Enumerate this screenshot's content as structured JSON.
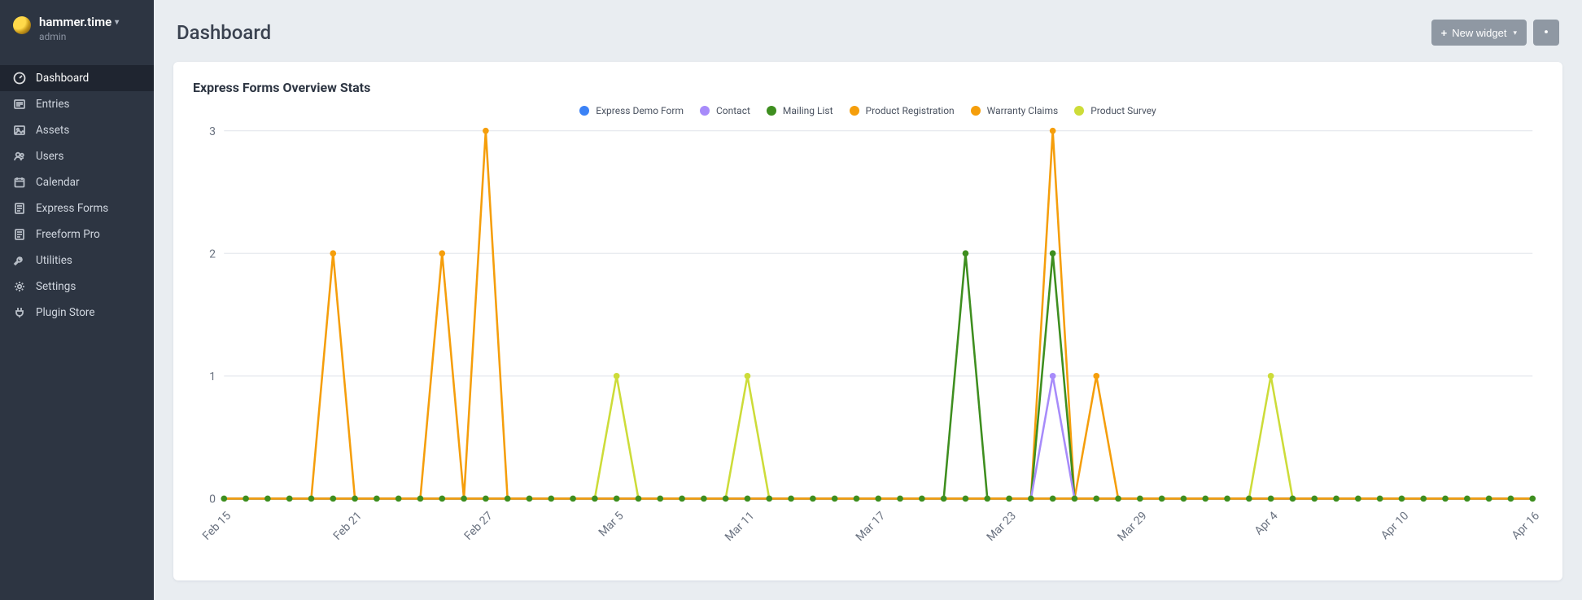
{
  "site": {
    "name": "hammer.time",
    "role": "admin"
  },
  "page": {
    "title": "Dashboard"
  },
  "toolbar": {
    "new_widget_label": "New widget"
  },
  "sidebar": {
    "items": [
      {
        "label": "Dashboard",
        "icon": "dashboard-icon",
        "active": true
      },
      {
        "label": "Entries",
        "icon": "entries-icon",
        "active": false
      },
      {
        "label": "Assets",
        "icon": "image-icon",
        "active": false
      },
      {
        "label": "Users",
        "icon": "users-icon",
        "active": false
      },
      {
        "label": "Calendar",
        "icon": "calendar-icon",
        "active": false
      },
      {
        "label": "Express Forms",
        "icon": "form-icon",
        "active": false
      },
      {
        "label": "Freeform Pro",
        "icon": "form-icon",
        "active": false
      },
      {
        "label": "Utilities",
        "icon": "wrench-icon",
        "active": false
      },
      {
        "label": "Settings",
        "icon": "gear-icon",
        "active": false
      },
      {
        "label": "Plugin Store",
        "icon": "plug-icon",
        "active": false
      }
    ]
  },
  "panel": {
    "title": "Express Forms Overview Stats"
  },
  "chart_data": {
    "type": "line",
    "ylabel": "",
    "xlabel": "",
    "ylim": [
      0,
      3
    ],
    "y_ticks": [
      0,
      1,
      2,
      3
    ],
    "categories": [
      "Feb 15",
      "Feb 16",
      "Feb 17",
      "Feb 18",
      "Feb 19",
      "Feb 20",
      "Feb 21",
      "Feb 22",
      "Feb 23",
      "Feb 24",
      "Feb 25",
      "Feb 26",
      "Feb 27",
      "Feb 28",
      "Mar 1",
      "Mar 2",
      "Mar 3",
      "Mar 4",
      "Mar 5",
      "Mar 6",
      "Mar 7",
      "Mar 8",
      "Mar 9",
      "Mar 10",
      "Mar 11",
      "Mar 12",
      "Mar 13",
      "Mar 14",
      "Mar 15",
      "Mar 16",
      "Mar 17",
      "Mar 18",
      "Mar 19",
      "Mar 20",
      "Mar 21",
      "Mar 22",
      "Mar 23",
      "Mar 24",
      "Mar 25",
      "Mar 26",
      "Mar 27",
      "Mar 28",
      "Mar 29",
      "Mar 30",
      "Mar 31",
      "Apr 1",
      "Apr 2",
      "Apr 3",
      "Apr 4",
      "Apr 5",
      "Apr 6",
      "Apr 7",
      "Apr 8",
      "Apr 9",
      "Apr 10",
      "Apr 11",
      "Apr 12",
      "Apr 13",
      "Apr 14",
      "Apr 15",
      "Apr 16"
    ],
    "x_tick_labels": [
      "Feb 15",
      "Feb 21",
      "Feb 27",
      "Mar 5",
      "Mar 11",
      "Mar 17",
      "Mar 23",
      "Mar 29",
      "Apr 4",
      "Apr 10",
      "Apr 16"
    ],
    "series": [
      {
        "name": "Express Demo Form",
        "color": "#3b82f6",
        "values": [
          0,
          0,
          0,
          0,
          0,
          0,
          0,
          0,
          0,
          0,
          0,
          0,
          0,
          0,
          0,
          0,
          0,
          0,
          0,
          0,
          0,
          0,
          0,
          0,
          0,
          0,
          0,
          0,
          0,
          0,
          0,
          0,
          0,
          0,
          0,
          0,
          0,
          0,
          0,
          0,
          0,
          0,
          0,
          0,
          0,
          0,
          0,
          0,
          0,
          0,
          0,
          0,
          0,
          0,
          0,
          0,
          0,
          0,
          0,
          0,
          0
        ]
      },
      {
        "name": "Contact",
        "color": "#a78bfa",
        "values": [
          0,
          0,
          0,
          0,
          0,
          0,
          0,
          0,
          0,
          0,
          0,
          0,
          0,
          0,
          0,
          0,
          0,
          0,
          0,
          0,
          0,
          0,
          0,
          0,
          0,
          0,
          0,
          0,
          0,
          0,
          0,
          0,
          0,
          0,
          0,
          0,
          0,
          0,
          1,
          0,
          0,
          0,
          0,
          0,
          0,
          0,
          0,
          0,
          0,
          0,
          0,
          0,
          0,
          0,
          0,
          0,
          0,
          0,
          0,
          0,
          0
        ]
      },
      {
        "name": "Mailing List",
        "color": "#3e8e1f",
        "values": [
          0,
          0,
          0,
          0,
          0,
          0,
          0,
          0,
          0,
          0,
          0,
          0,
          0,
          0,
          0,
          0,
          0,
          0,
          0,
          0,
          0,
          0,
          0,
          0,
          0,
          0,
          0,
          0,
          0,
          0,
          0,
          0,
          0,
          0,
          2,
          0,
          0,
          0,
          2,
          0,
          0,
          0,
          0,
          0,
          0,
          0,
          0,
          0,
          0,
          0,
          0,
          0,
          0,
          0,
          0,
          0,
          0,
          0,
          0,
          0,
          0
        ]
      },
      {
        "name": "Product Registration",
        "color": "#f59e0b",
        "values": [
          0,
          0,
          0,
          0,
          0,
          2,
          0,
          0,
          0,
          0,
          2,
          0,
          3,
          0,
          0,
          0,
          0,
          0,
          0,
          0,
          0,
          0,
          0,
          0,
          0,
          0,
          0,
          0,
          0,
          0,
          0,
          0,
          0,
          0,
          0,
          0,
          0,
          0,
          3,
          0,
          1,
          0,
          0,
          0,
          0,
          0,
          0,
          0,
          0,
          0,
          0,
          0,
          0,
          0,
          0,
          0,
          0,
          0,
          0,
          0,
          0
        ]
      },
      {
        "name": "Warranty Claims",
        "color": "#f59e0b",
        "values": [
          0,
          0,
          0,
          0,
          0,
          0,
          0,
          0,
          0,
          0,
          0,
          0,
          0,
          0,
          0,
          0,
          0,
          0,
          0,
          0,
          0,
          0,
          0,
          0,
          0,
          0,
          0,
          0,
          0,
          0,
          0,
          0,
          0,
          0,
          0,
          0,
          0,
          0,
          0,
          0,
          0,
          0,
          0,
          0,
          0,
          0,
          0,
          0,
          0,
          0,
          0,
          0,
          0,
          0,
          0,
          0,
          0,
          0,
          0,
          0,
          0
        ]
      },
      {
        "name": "Product Survey",
        "color": "#cddc39",
        "values": [
          0,
          0,
          0,
          0,
          0,
          0,
          0,
          0,
          0,
          0,
          0,
          0,
          0,
          0,
          0,
          0,
          0,
          0,
          1,
          0,
          0,
          0,
          0,
          0,
          1,
          0,
          0,
          0,
          0,
          0,
          0,
          0,
          0,
          0,
          0,
          0,
          0,
          0,
          0,
          0,
          0,
          0,
          0,
          0,
          0,
          0,
          0,
          0,
          1,
          0,
          0,
          0,
          0,
          0,
          0,
          0,
          0,
          0,
          0,
          0,
          0
        ]
      }
    ]
  },
  "colors": {
    "point_default": "#3e8e1f"
  }
}
